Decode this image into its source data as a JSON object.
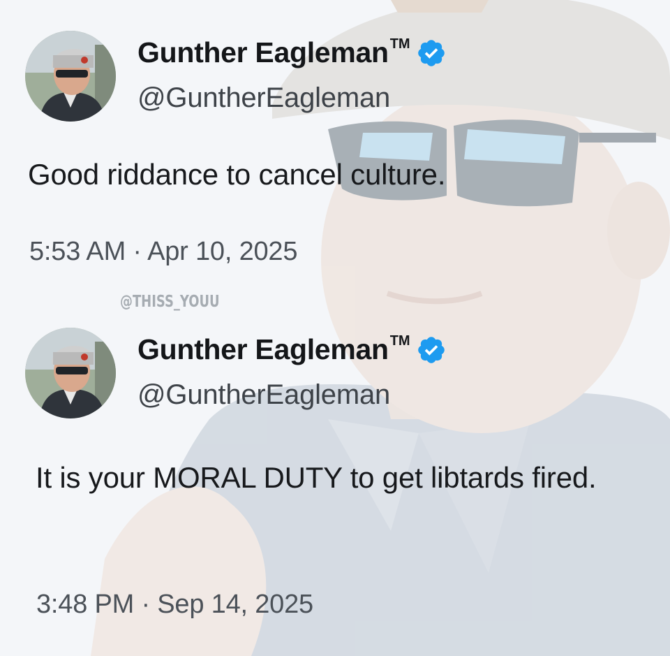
{
  "tweets": [
    {
      "display_name": "Gunther Eagleman",
      "trademark": "TM",
      "handle": "@GuntherEagleman",
      "text": "Good riddance to cancel culture.",
      "timestamp": "5:53 AM · Apr 10, 2025",
      "verified_icon": "verified-badge-icon",
      "avatar_icon": "profile-photo"
    },
    {
      "display_name": "Gunther Eagleman",
      "trademark": "TM",
      "handle": "@GuntherEagleman",
      "text": "It is your MORAL DUTY to get libtards fired.",
      "timestamp": "3:48 PM · Sep 14, 2025",
      "verified_icon": "verified-badge-icon",
      "avatar_icon": "profile-photo"
    }
  ],
  "watermark": "@THISS_YOUU",
  "colors": {
    "verified_blue": "#1d9bf0",
    "background": "#f4f6f9"
  }
}
